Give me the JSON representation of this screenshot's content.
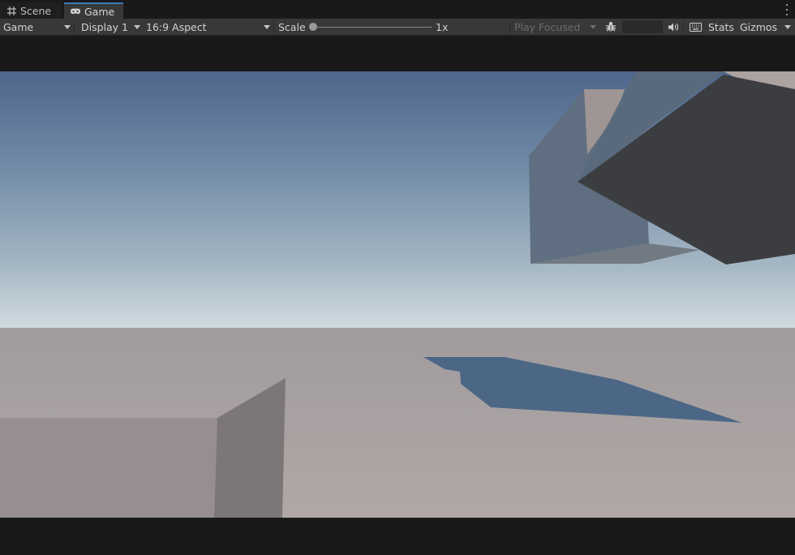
{
  "tabs": [
    {
      "label": "Scene",
      "icon": "grid-icon"
    },
    {
      "label": "Game",
      "icon": "gamepad-icon",
      "active": true
    }
  ],
  "toolbar": {
    "mode_dropdown": "Game",
    "display_dropdown": "Display 1",
    "aspect_dropdown": "16:9 Aspect",
    "scale_label": "Scale",
    "scale_value": "1x",
    "scale_level": 0,
    "play_focused": "Play Focused",
    "stats_label": "Stats",
    "gizmos_label": "Gizmos"
  },
  "colors": {
    "active_tab_accent": "#3a79bb",
    "toolbar_bg": "#383838",
    "sky_top": "#4f6a8e",
    "sky_horizon": "#c8d4da",
    "ground": "#a9a2a2",
    "shadow": "#4a6584"
  }
}
